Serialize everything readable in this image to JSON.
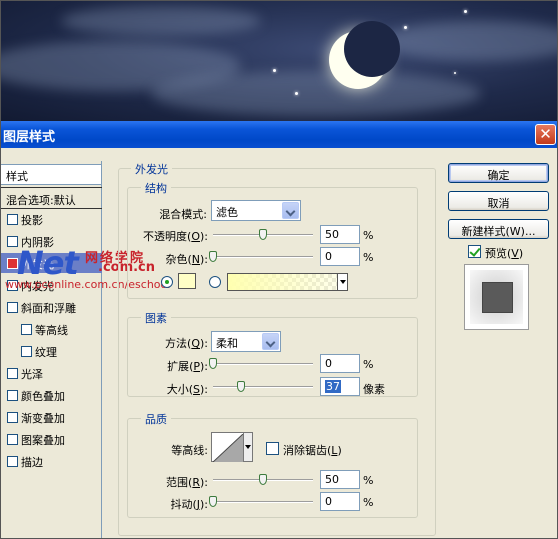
{
  "window": {
    "title": "图层样式"
  },
  "sidebar": {
    "header": "样式",
    "blend_options": "混合选项:默认",
    "items": [
      {
        "label": "投影",
        "checked": false
      },
      {
        "label": "内阴影",
        "checked": false
      },
      {
        "label": "外发光",
        "checked": true
      },
      {
        "label": "内发光",
        "checked": false
      },
      {
        "label": "斜面和浮雕",
        "checked": false
      },
      {
        "label": "等高线",
        "checked": false
      },
      {
        "label": "纹理",
        "checked": false
      },
      {
        "label": "光泽",
        "checked": false
      },
      {
        "label": "颜色叠加",
        "checked": false
      },
      {
        "label": "渐变叠加",
        "checked": false
      },
      {
        "label": "图案叠加",
        "checked": false
      },
      {
        "label": "描边",
        "checked": false
      }
    ]
  },
  "watermark": {
    "brand": "Net",
    "cn": "网络学院",
    "com": ".com.cn",
    "url": "www.pconline.com.cn/eschool"
  },
  "outer_glow": {
    "title": "外发光",
    "structure": {
      "title": "结构",
      "blend_mode_label": "混合模式:",
      "blend_mode_value": "滤色",
      "opacity_label": "不透明度",
      "opacity_key": "O",
      "opacity_value": "50",
      "opacity_fraction": 0.5,
      "noise_label": "杂色",
      "noise_key": "N",
      "noise_value": "0",
      "noise_fraction": 0,
      "unit_percent": "%"
    },
    "elements": {
      "title": "图素",
      "method_label": "方法",
      "method_key": "Q",
      "method_value": "柔和",
      "spread_label": "扩展",
      "spread_key": "P",
      "spread_value": "0",
      "spread_fraction": 0,
      "size_label": "大小",
      "size_key": "S",
      "size_value": "37",
      "size_unit": "像素"
    },
    "quality": {
      "title": "品质",
      "contour_label": "等高线:",
      "antialias_label": "消除锯齿",
      "antialias_key": "L",
      "range_label": "范围",
      "range_key": "R",
      "range_value": "50",
      "range_fraction": 0.5,
      "jitter_label": "抖动",
      "jitter_key": "J",
      "jitter_value": "0",
      "jitter_fraction": 0
    }
  },
  "buttons": {
    "ok": "确定",
    "cancel": "取消",
    "new_style": "新建样式(W)...",
    "preview_label": "预览",
    "preview_key": "V"
  },
  "colors": {
    "glow_color": "#ffffc6",
    "titlebar": "#0a55d8",
    "selected_item": "#6b7fc7"
  }
}
